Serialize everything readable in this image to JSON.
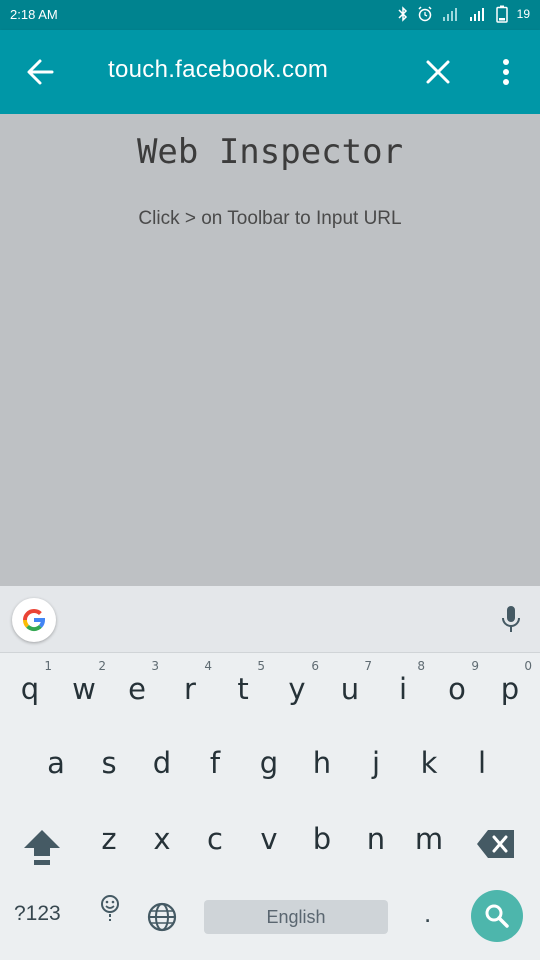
{
  "status_bar": {
    "time": "2:18 AM",
    "battery": "19",
    "icons": [
      "bluetooth-icon",
      "alarm-icon",
      "signal-icon",
      "signal-icon",
      "battery-icon"
    ]
  },
  "toolbar": {
    "url": "touch.facebook.com",
    "back_icon": "arrow-left-icon",
    "close_icon": "close-icon",
    "menu_icon": "more-vert-icon"
  },
  "content": {
    "heading": "Web Inspector",
    "subtitle": "Click > on Toolbar to Input URL"
  },
  "keyboard": {
    "suggestion_bar": {
      "logo": "google-icon",
      "mic": "mic-icon"
    },
    "row1": [
      {
        "key": "q",
        "hint": "1"
      },
      {
        "key": "w",
        "hint": "2"
      },
      {
        "key": "e",
        "hint": "3"
      },
      {
        "key": "r",
        "hint": "4"
      },
      {
        "key": "t",
        "hint": "5"
      },
      {
        "key": "y",
        "hint": "6"
      },
      {
        "key": "u",
        "hint": "7"
      },
      {
        "key": "i",
        "hint": "8"
      },
      {
        "key": "o",
        "hint": "9"
      },
      {
        "key": "p",
        "hint": "0"
      }
    ],
    "row2": [
      "a",
      "s",
      "d",
      "f",
      "g",
      "h",
      "j",
      "k",
      "l"
    ],
    "row3": [
      "z",
      "x",
      "c",
      "v",
      "b",
      "n",
      "m"
    ],
    "bottom": {
      "symbols": "?123",
      "space": "English",
      "period": "."
    },
    "colors": {
      "background": "#eceff1",
      "search": "#4db6ac",
      "toolbar": "#0097a7"
    }
  }
}
